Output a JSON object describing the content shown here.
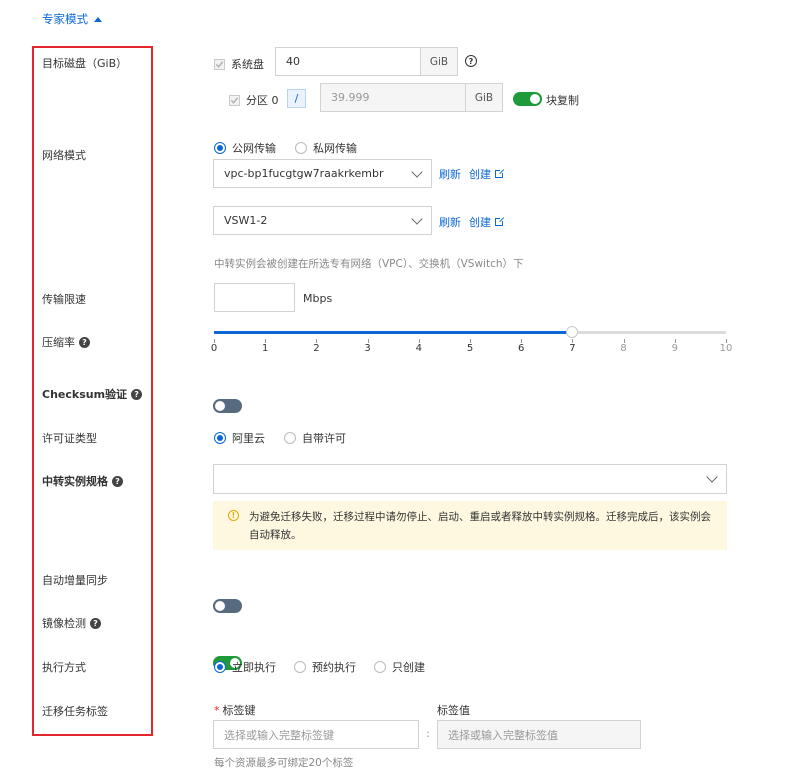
{
  "expert_toggle": {
    "label": "专家模式"
  },
  "labels": {
    "target_disk": "目标磁盘（GiB）",
    "network_mode": "网络模式",
    "transfer_limit": "传输限速",
    "compression": "压缩率",
    "checksum": "Checksum验证",
    "license_type": "许可证类型",
    "relay_spec": "中转实例规格",
    "auto_incremental": "自动增量同步",
    "image_check": "镜像检测",
    "execution": "执行方式",
    "migration_tags": "迁移任务标签"
  },
  "disk": {
    "system_label": "系统盘",
    "system_value": "40",
    "unit": "GiB",
    "partition_label": "分区 0",
    "partition_slash": "/",
    "partition_value": "39.999",
    "block_copy_label": "块复制"
  },
  "network": {
    "options": [
      "公网传输",
      "私网传输"
    ],
    "selected": 0,
    "vpc_value": "vpc-bp1fucgtgw7raakrkembr",
    "vswitch_value": "VSW1-2",
    "refresh": "刷新",
    "create": "创建",
    "hint": "中转实例会被创建在所选专有网络（VPC）、交换机（VSwitch）下"
  },
  "speed": {
    "value": "",
    "unit": "Mbps"
  },
  "compression": {
    "value": 7,
    "min": 0,
    "max": 10,
    "ticks": [
      "0",
      "1",
      "2",
      "3",
      "4",
      "5",
      "6",
      "7",
      "8",
      "9",
      "10"
    ]
  },
  "checksum": {
    "enabled": false
  },
  "license": {
    "options": [
      "阿里云",
      "自带许可"
    ],
    "selected": 0
  },
  "relay_spec": {
    "value": "",
    "warning": "为避免迁移失败，迁移过程中请勿停止、启动、重启或者释放中转实例规格。迁移完成后，该实例会自动释放。"
  },
  "auto_incremental": {
    "enabled": false
  },
  "image_check": {
    "enabled": true
  },
  "execution": {
    "options": [
      "立即执行",
      "预约执行",
      "只创建"
    ],
    "selected": 0
  },
  "tags": {
    "key_required": "*",
    "key_label": "标签键",
    "value_label": "标签值",
    "key_placeholder": "选择或输入完整标签键",
    "value_placeholder": "选择或输入完整标签值",
    "separator": ":",
    "limit_hint": "每个资源最多可绑定20个标签"
  },
  "colors": {
    "accent": "#0b67d6",
    "highlight_box": "#e3262b",
    "switch_on": "#1f9a3a",
    "switch_off": "#566a80"
  }
}
